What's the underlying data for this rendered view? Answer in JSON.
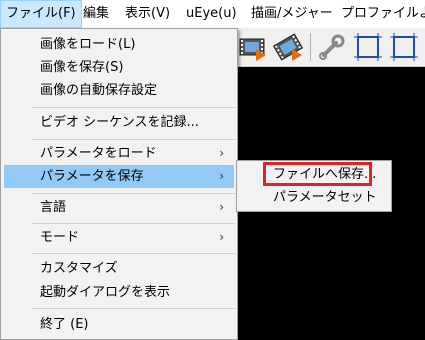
{
  "menubar": {
    "items": [
      {
        "label": "ファイル(F)"
      },
      {
        "label": "編集"
      },
      {
        "label": "表示(V)"
      },
      {
        "label": "uEye(u)"
      },
      {
        "label": "描画/メジャー"
      },
      {
        "label": "プロファイル"
      },
      {
        "label": "よ"
      }
    ]
  },
  "toolbar": {
    "icons": [
      "film-strip-icon",
      "film-strip-record-icon",
      "wrench-icon",
      "frame-icon",
      "frame-icon"
    ]
  },
  "file_menu": {
    "items": [
      {
        "label": "画像をロード(L)"
      },
      {
        "label": "画像を保存(S)"
      },
      {
        "label": "画像の自動保存設定"
      },
      {
        "label": "ビデオ シーケンスを記録..."
      },
      {
        "label": "パラメータをロード",
        "arrow": "›"
      },
      {
        "label": "パラメータを保存",
        "arrow": "›"
      },
      {
        "label": "言語",
        "arrow": "›"
      },
      {
        "label": "モード",
        "arrow": "›"
      },
      {
        "label": "カスタマイズ"
      },
      {
        "label": "起動ダイアログを表示"
      },
      {
        "label": "終了 (E)"
      }
    ]
  },
  "submenu": {
    "items": [
      {
        "label": "ファイルへ保存..."
      },
      {
        "label": "パラメータセット"
      }
    ]
  },
  "colors": {
    "highlight": "#91c9f7",
    "annotation": "#e0202a",
    "canvas": "#000000"
  }
}
